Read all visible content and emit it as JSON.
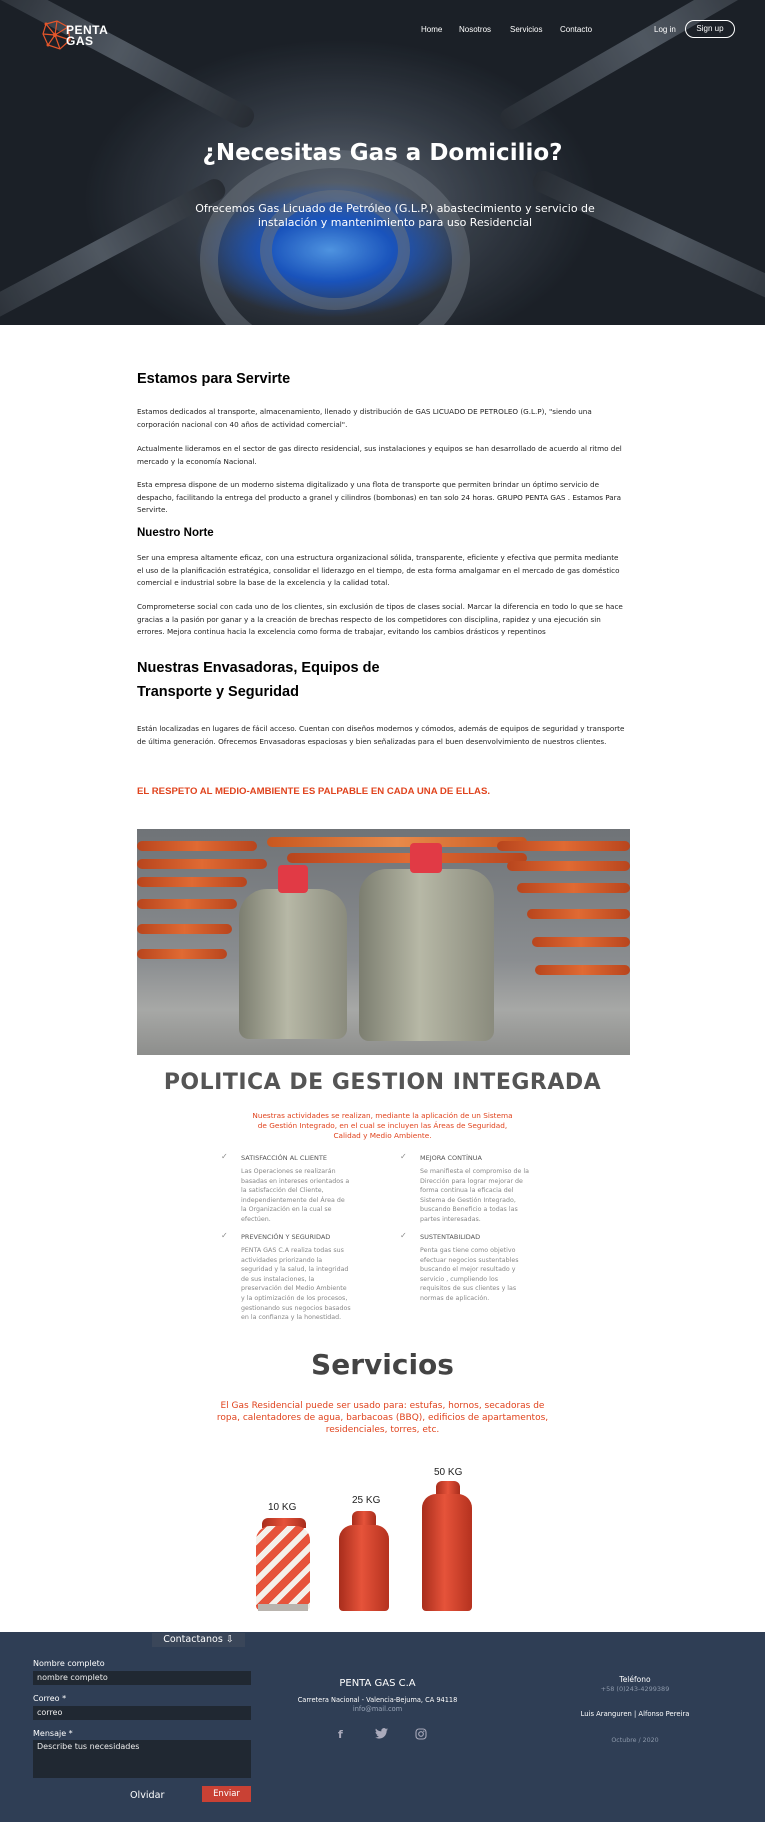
{
  "header": {
    "logo_text_1": "PENTA",
    "logo_text_2": "GAS",
    "nav": [
      "Home",
      "Nosotros",
      "Servicios",
      "Contacto"
    ],
    "login": "Log in",
    "signup": "Sign up"
  },
  "hero": {
    "title": "¿Necesitas Gas a Domicilio?",
    "subtitle": "Ofrecemos Gas Licuado de Petróleo (G.L.P.) abastecimiento y servicio de instalación y mantenimiento para uso Residencial"
  },
  "about": {
    "title": "Estamos para Servirte",
    "p1": "Estamos dedicados al transporte, almacenamiento, llenado y distribución de GAS LICUADO DE PETROLEO (G.L.P), \"siendo una corporación nacional con 40 años de actividad comercial\".",
    "p2": "Actualmente lideramos  en el sector de gas directo residencial, sus instalaciones y equipos se han desarrollado de acuerdo al ritmo del mercado y la economía  Nacional.",
    "p3": "Esta empresa dispone de un moderno sistema digitalizado y una flota de transporte que permiten brindar un óptimo servicio de despacho, facilitando la entrega del producto a granel y cilindros (bombonas) en tan solo 24 horas. GRUPO PENTA GAS . Estamos Para Servirte."
  },
  "norte": {
    "title": "Nuestro Norte",
    "p1": "Ser una empresa altamente eficaz, con una estructura organizacional sólida, transparente, eficiente y efectiva que permita mediante el uso de la planificación estratégica, consolidar el liderazgo en el tiempo, de esta forma amalgamar en el mercado de gas doméstico comercial e industrial sobre la base de la excelencia y la calidad total.",
    "p2": "Comprometerse social  con cada uno de los clientes, sin exclusión de tipos de clases social. Marcar la diferencia en todo lo que se hace gracias a la pasión por ganar y a la creación de brechas respecto de los competidores con disciplina, rapidez y una ejecución sin errores. Mejora continua hacia  la excelencia como forma de trabajar, evitando los cambios drásticos y repentinos"
  },
  "envasadoras": {
    "title_1": "Nuestras Envasadoras, Equipos de",
    "title_2": "Transporte y Seguridad",
    "p1": "Están localizadas en lugares de fácil acceso. Cuentan con diseños modernos y cómodos, además de equipos de seguridad y transporte de última generación. Ofrecemos Envasadoras espaciosas y bien señalizadas para el buen desenvolvimiento de nuestros clientes.",
    "highlight": "EL RESPETO AL MEDIO-AMBIENTE ES PALPABLE EN CADA UNA DE ELLAS."
  },
  "politica": {
    "title": "POLITICA DE GESTION INTEGRADA",
    "intro": "Nuestras actividades se realizan, mediante la aplicación de un Sistema de Gestión Integrado, en el cual se incluyen las Áreas de Seguridad, Calidad y Medio Ambiente.",
    "items": [
      {
        "title": "SATISFACCIÓN AL CLIENTE",
        "text": "Las Operaciones se realizarán basadas en intereses orientados a la satisfacción del Cliente, independientemente del Área de la Organización en la cual se efectúen."
      },
      {
        "title": "MEJORA CONTÍNUA",
        "text": "Se manifiesta el compromiso de la Dirección para lograr mejorar de forma continua la eficacia del Sistema de Gestión Integrado, buscando Beneficio a todas las partes interesadas."
      },
      {
        "title": "PREVENCIÓN Y SEGURIDAD",
        "text": "PENTA GAS C.A realiza todas sus actividades priorizando la seguridad y la salud, la integridad de sus instalaciones, la preservación del Medio Ambiente y la optimización de los procesos, gestionando sus negocios basados en la confianza y la honestidad."
      },
      {
        "title": "SUSTENTABILIDAD",
        "text": "Penta gas tiene como objetivo efectuar negocios sustentables buscando el mejor resultado y servicio , cumpliendo los requisitos de sus clientes y las normas de aplicación."
      }
    ]
  },
  "servicios": {
    "title": "Servicios",
    "text": "El Gas Residencial puede ser usado para: estufas, hornos, secadoras de ropa, calentadores de agua, barbacoas (BBQ), edificios de apartamentos, residenciales, torres, etc.",
    "cylinders": [
      "10 KG",
      "25 KG",
      "50 KG"
    ]
  },
  "footer": {
    "contact_tab": "Contactanos ⇩",
    "form": {
      "name_label": "Nombre completo",
      "name_value": "nombre completo",
      "email_label": "Correo *",
      "email_value": "correo",
      "message_label": "Mensaje *",
      "message_value": "Describe tus necesidades",
      "clear": "Olvidar",
      "send": "Enviar"
    },
    "company": "PENTA GAS C.A",
    "address": "Carretera Nacional - Valencia-Bejuma, CA 94118",
    "email": "info@mail.com",
    "phone_label": "Teléfono",
    "phone": "+58 (0)243-4299389",
    "names": "Luis Aranguren | Alfonso Pereira",
    "date": "Octubre / 2020",
    "colors": {
      "bg": "#2f3e55",
      "accent": "#e0431d"
    }
  }
}
